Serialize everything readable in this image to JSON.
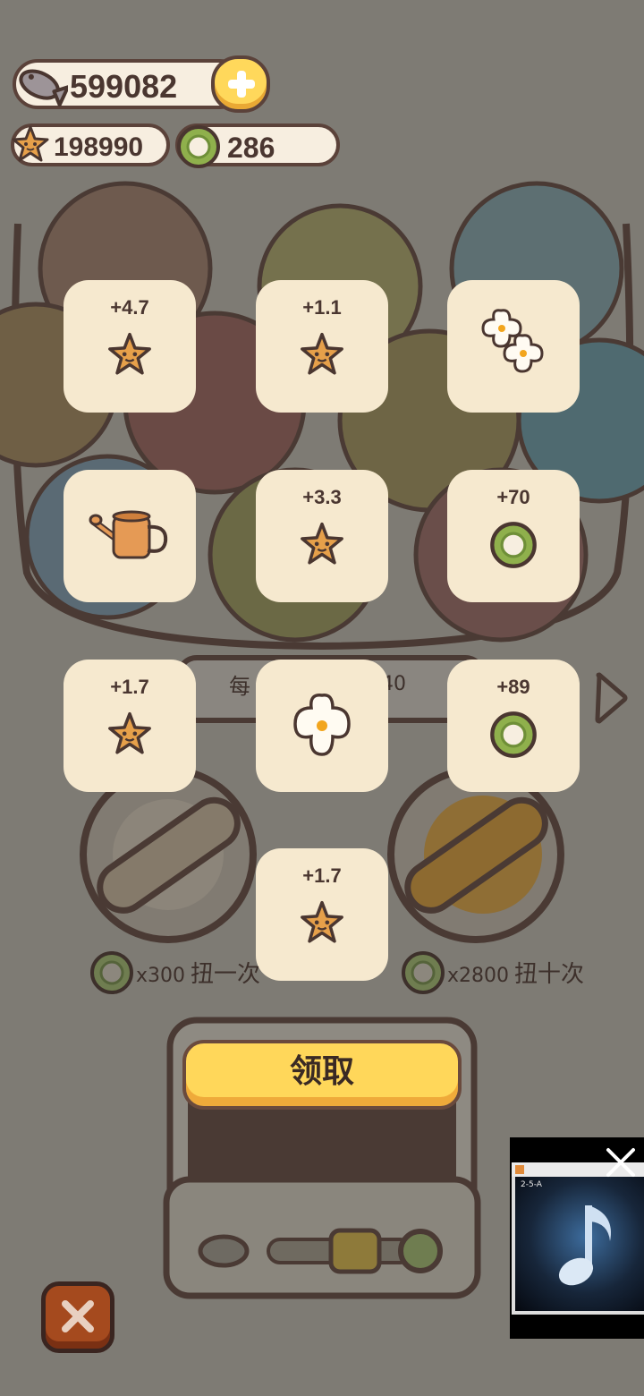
{
  "currency": {
    "fish": "599082",
    "stars": "198990",
    "coins": "286"
  },
  "rewards": [
    {
      "amount": "+4.7",
      "icon": "star-icon"
    },
    {
      "amount": "+1.1",
      "icon": "star-icon"
    },
    {
      "amount": "",
      "icon": "double-flower-icon"
    },
    {
      "amount": "",
      "icon": "watering-can-icon"
    },
    {
      "amount": "+3.3",
      "icon": "star-icon"
    },
    {
      "amount": "+70",
      "icon": "coin-icon"
    },
    {
      "amount": "+1.7",
      "icon": "star-icon"
    },
    {
      "amount": "",
      "icon": "flower-icon"
    },
    {
      "amount": "+89",
      "icon": "coin-icon"
    },
    {
      "amount": "+1.7",
      "icon": "star-icon"
    }
  ],
  "gacha": {
    "single_cost": "x300",
    "single_label": "扭一次",
    "ten_cost": "x2800",
    "ten_label": "扭十次",
    "partial_left": "每",
    "partial_right": "40"
  },
  "claim_label": "领取",
  "video_overlay": {
    "title": "2-5-A"
  },
  "colors": {
    "tile": "#f6e9cf",
    "claim_button": "#ffd75a",
    "close_button": "#a54a1e",
    "outline": "#5b423a"
  }
}
